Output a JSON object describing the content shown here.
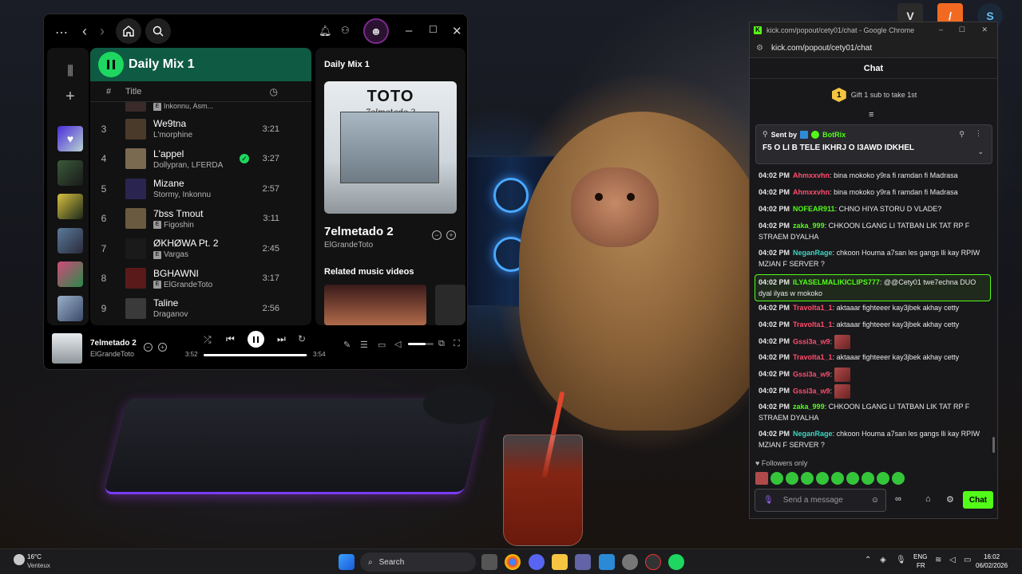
{
  "desktop": {
    "tray_icons": [
      "gta-icon",
      "app-icon",
      "steam-icon"
    ]
  },
  "spotify": {
    "playlist_title": "Daily Mix 1",
    "col_num": "#",
    "col_title": "Title",
    "partial_row_artist": "Inkonnu, Asm...",
    "tracks": [
      {
        "num": "3",
        "title": "We9tna",
        "artist": "L'morphine",
        "explicit": false,
        "duration": "3:21",
        "saved": false,
        "color": "#4a3a2a"
      },
      {
        "num": "4",
        "title": "L'appel",
        "artist": "Dollypran, LFERDA",
        "explicit": false,
        "duration": "3:27",
        "saved": true,
        "color": "#7a6a50"
      },
      {
        "num": "5",
        "title": "Mizane",
        "artist": "Stormy, Inkonnu",
        "explicit": false,
        "duration": "2:57",
        "saved": false,
        "color": "#2a2550"
      },
      {
        "num": "6",
        "title": "7bss Tmout",
        "artist": "Figoshin",
        "explicit": true,
        "duration": "3:11",
        "saved": false,
        "color": "#6a5a40"
      },
      {
        "num": "7",
        "title": "ØKHØWA Pt. 2",
        "artist": "Vargas",
        "explicit": true,
        "duration": "2:45",
        "saved": false,
        "color": "#1a1a1a"
      },
      {
        "num": "8",
        "title": "BGHAWNI",
        "artist": "ElGrandeToto",
        "explicit": true,
        "duration": "3:17",
        "saved": false,
        "color": "#5a1a1a"
      },
      {
        "num": "9",
        "title": "Taline",
        "artist": "Draganov",
        "explicit": false,
        "duration": "2:56",
        "saved": false,
        "color": "#3a3a3a"
      }
    ],
    "right_panel": {
      "header": "Daily Mix 1",
      "cover_title": "TOTO",
      "cover_subtitle": "7elmetado 2",
      "song_title": "7elmetado 2",
      "song_artist": "ElGrandeToto",
      "related_label": "Related music videos"
    },
    "player": {
      "title": "7elmetado 2",
      "artist": "ElGrandeToto",
      "elapsed": "3:52",
      "total": "3:54",
      "progress": 0.99,
      "volume": 0.7
    }
  },
  "chrome": {
    "window_title": "kick.com/popout/cety01/chat - Google Chrome",
    "address": "kick.com/popout/cety01/chat",
    "tab_label": "Chat",
    "gift_count": "1",
    "gift_text": "Gift 1 sub to take 1st",
    "pinned": {
      "sent_by": "Sent by",
      "bot": "BotRix",
      "message": "F5 O LI B TELE IKHRJ O I3AWD IDKHEL"
    },
    "messages": [
      {
        "time": "04:02 PM",
        "user": "Ahmxxvhn",
        "color": "#ff4d6d",
        "text": "bina mokoko y9ra fi ramdan fi Madrasa"
      },
      {
        "time": "04:02 PM",
        "user": "Ahmxxvhn",
        "color": "#ff4d6d",
        "text": "bina mokoko y9ra fi ramdan fi Madrasa"
      },
      {
        "time": "04:02 PM",
        "user": "NOFEAR911",
        "color": "#53fc18",
        "text": "CHNO HIYA STORU D VLADE?"
      },
      {
        "time": "04:02 PM",
        "user": "zaka_999",
        "color": "#53fc18",
        "text": "CHKOON LGANG LI TATBAN LIK TAT RP F STRAEM DYALHA"
      },
      {
        "time": "04:02 PM",
        "user": "NeganRage",
        "color": "#3fd4c0",
        "text": "chkoon Houma a7san les gangs lli kay RPIW MZIAN F SERVER ?"
      },
      {
        "time": "04:02 PM",
        "user": "ILYASELMALIKICLIPS777",
        "color": "#53fc18",
        "text": "@@Cety01 twe7echna DUO dyal ilyas w mokoko"
      },
      {
        "time": "04:02 PM",
        "user": "Travolta1_1",
        "color": "#ff4d6d",
        "text": "aktaaar fighteeer kay3jbek akhay cetty"
      },
      {
        "time": "04:02 PM",
        "user": "Travolta1_1",
        "color": "#ff4d6d",
        "text": "aktaaar fighteeer kay3jbek akhay cetty"
      },
      {
        "time": "04:02 PM",
        "user": "Gssi3a_w9",
        "color": "#ff4d6d",
        "text": ""
      },
      {
        "time": "04:02 PM",
        "user": "Travolta1_1",
        "color": "#ff4d6d",
        "text": "aktaaar fighteeer kay3jbek akhay cetty"
      },
      {
        "time": "04:02 PM",
        "user": "Gssi3a_w9",
        "color": "#ff4d6d",
        "text": ""
      },
      {
        "time": "04:02 PM",
        "user": "Gssi3a_w9",
        "color": "#ff4d6d",
        "text": ""
      },
      {
        "time": "04:02 PM",
        "user": "zaka_999",
        "color": "#53fc18",
        "text": "CHKOON LGANG LI TATBAN LIK TAT RP F STRAEM DYALHA"
      },
      {
        "time": "04:02 PM",
        "user": "NeganRage",
        "color": "#3fd4c0",
        "text": "chkoon Houma a7san les gangs lli kay RPIW MZIAN F SERVER ?"
      }
    ],
    "followers_only": "Followers only",
    "input_placeholder": "Send a message",
    "chat_button": "Chat"
  },
  "taskbar": {
    "weather_temp": "16°C",
    "weather_desc": "Venteux",
    "search_label": "Search",
    "lang_top": "ENG",
    "lang_bottom": "FR",
    "time": "16:02",
    "date": "06/02/2026"
  }
}
